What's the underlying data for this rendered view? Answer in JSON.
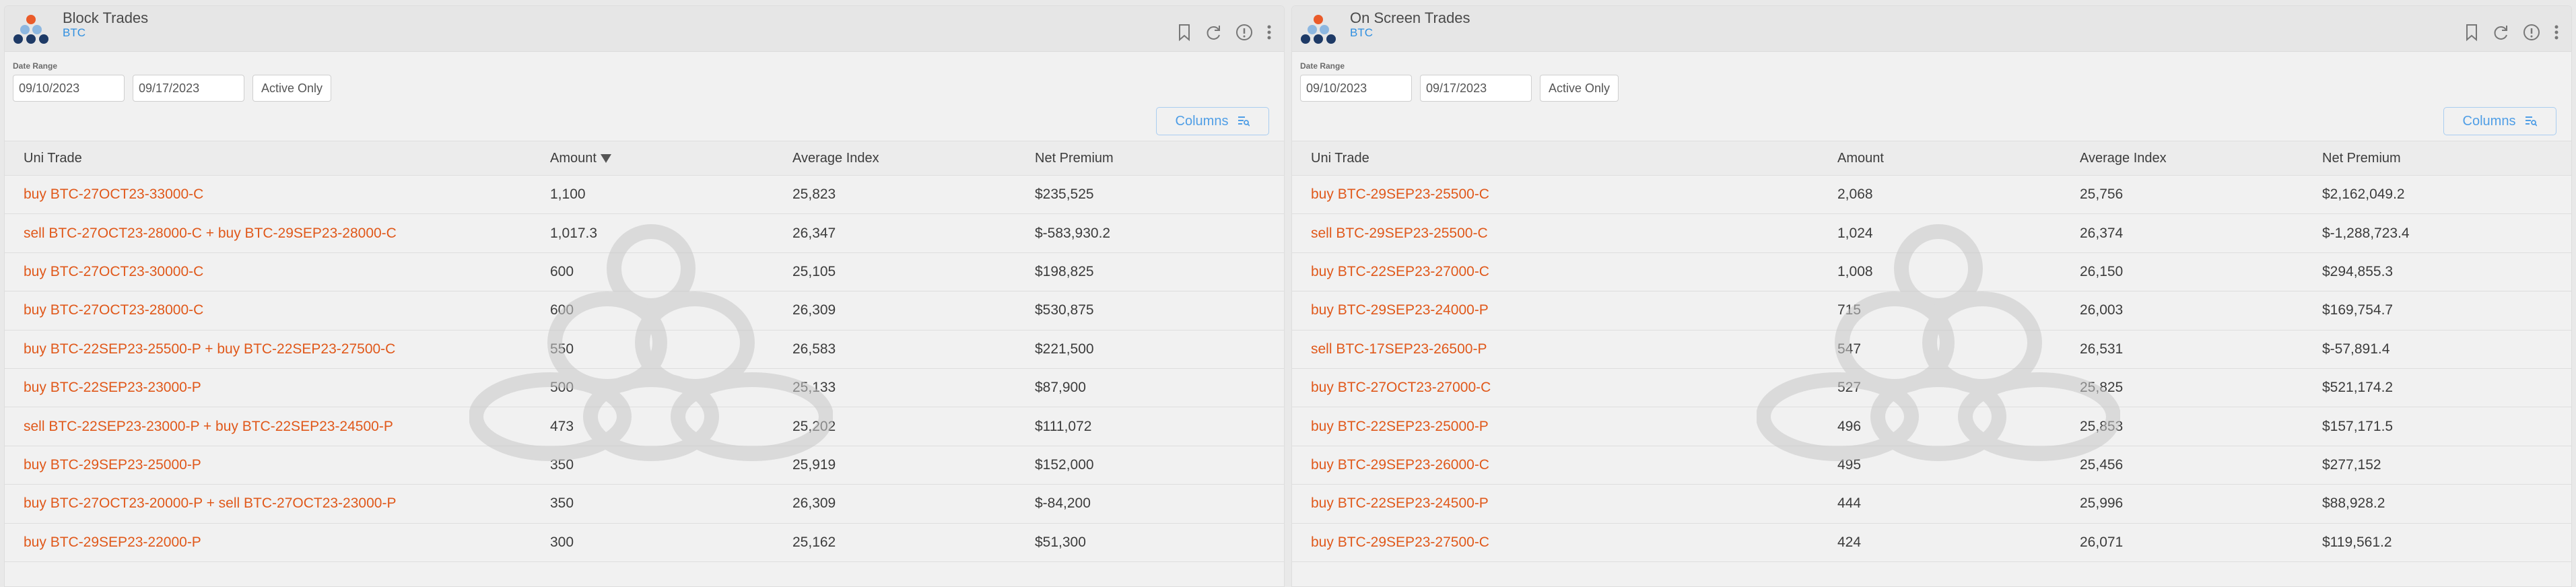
{
  "panels": [
    {
      "title": "Block Trades",
      "subtitle": "BTC",
      "filters": {
        "label": "Date Range",
        "from": "09/10/2023",
        "to": "09/17/2023",
        "active_label": "Active Only"
      },
      "columns_label": "Columns",
      "headers": [
        "Uni Trade",
        "Amount",
        "Average Index",
        "Net Premium"
      ],
      "rows": [
        {
          "trade": "buy BTC-27OCT23-33000-C",
          "amount": "1,100",
          "index": "25,823",
          "premium": "$235,525"
        },
        {
          "trade": "sell BTC-27OCT23-28000-C + buy BTC-29SEP23-28000-C",
          "amount": "1,017.3",
          "index": "26,347",
          "premium": "$-583,930.2"
        },
        {
          "trade": "buy BTC-27OCT23-30000-C",
          "amount": "600",
          "index": "25,105",
          "premium": "$198,825"
        },
        {
          "trade": "buy BTC-27OCT23-28000-C",
          "amount": "600",
          "index": "26,309",
          "premium": "$530,875"
        },
        {
          "trade": "buy BTC-22SEP23-25500-P + buy BTC-22SEP23-27500-C",
          "amount": "550",
          "index": "26,583",
          "premium": "$221,500"
        },
        {
          "trade": "buy BTC-22SEP23-23000-P",
          "amount": "500",
          "index": "25,133",
          "premium": "$87,900"
        },
        {
          "trade": "sell BTC-22SEP23-23000-P + buy BTC-22SEP23-24500-P",
          "amount": "473",
          "index": "25,202",
          "premium": "$111,072"
        },
        {
          "trade": "buy BTC-29SEP23-25000-P",
          "amount": "350",
          "index": "25,919",
          "premium": "$152,000"
        },
        {
          "trade": "buy BTC-27OCT23-20000-P + sell BTC-27OCT23-23000-P",
          "amount": "350",
          "index": "26,309",
          "premium": "$-84,200"
        },
        {
          "trade": "buy BTC-29SEP23-22000-P",
          "amount": "300",
          "index": "25,162",
          "premium": "$51,300"
        }
      ]
    },
    {
      "title": "On Screen Trades",
      "subtitle": "BTC",
      "filters": {
        "label": "Date Range",
        "from": "09/10/2023",
        "to": "09/17/2023",
        "active_label": "Active Only"
      },
      "columns_label": "Columns",
      "headers": [
        "Uni Trade",
        "Amount",
        "Average Index",
        "Net Premium"
      ],
      "rows": [
        {
          "trade": "buy BTC-29SEP23-25500-C",
          "amount": "2,068",
          "index": "25,756",
          "premium": "$2,162,049.2"
        },
        {
          "trade": "sell BTC-29SEP23-25500-C",
          "amount": "1,024",
          "index": "26,374",
          "premium": "$-1,288,723.4"
        },
        {
          "trade": "buy BTC-22SEP23-27000-C",
          "amount": "1,008",
          "index": "26,150",
          "premium": "$294,855.3"
        },
        {
          "trade": "buy BTC-29SEP23-24000-P",
          "amount": "715",
          "index": "26,003",
          "premium": "$169,754.7"
        },
        {
          "trade": "sell BTC-17SEP23-26500-P",
          "amount": "547",
          "index": "26,531",
          "premium": "$-57,891.4"
        },
        {
          "trade": "buy BTC-27OCT23-27000-C",
          "amount": "527",
          "index": "25,825",
          "premium": "$521,174.2"
        },
        {
          "trade": "buy BTC-22SEP23-25000-P",
          "amount": "496",
          "index": "25,853",
          "premium": "$157,171.5"
        },
        {
          "trade": "buy BTC-29SEP23-26000-C",
          "amount": "495",
          "index": "25,456",
          "premium": "$277,152"
        },
        {
          "trade": "buy BTC-22SEP23-24500-P",
          "amount": "444",
          "index": "25,996",
          "premium": "$88,928.2"
        },
        {
          "trade": "buy BTC-29SEP23-27500-C",
          "amount": "424",
          "index": "26,071",
          "premium": "$119,561.2"
        }
      ]
    }
  ],
  "colors": {
    "trade_link": "#e0581a",
    "subtitle": "#2f8fe0",
    "columns_button": "#4f9ee6"
  },
  "icons": [
    "logo-icon",
    "bookmark-icon",
    "refresh-icon",
    "info-icon",
    "more-vertical-icon",
    "columns-filter-icon",
    "watermark-icon"
  ]
}
